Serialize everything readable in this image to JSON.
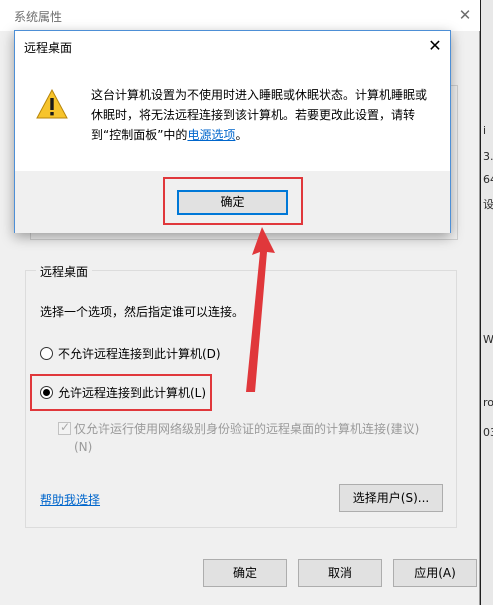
{
  "system_window": {
    "title": "系统属性",
    "close_glyph": "✕",
    "remote_desktop_group": {
      "legend": "远程桌面",
      "description": "选择一个选项，然后指定谁可以连接。",
      "option_disallow": "不允许远程连接到此计算机(D)",
      "option_allow": "允许远程连接到此计算机(L)",
      "selected_option": "allow",
      "nla_checkbox_label": "仅允许运行使用网络级别身份验证的远程桌面的计算机连接(建议)(N)",
      "nla_checked": true,
      "help_link": "帮助我选择",
      "select_users_button": "选择用户(S)..."
    },
    "buttons": {
      "ok": "确定",
      "cancel": "取消",
      "apply": "应用(A)"
    }
  },
  "dialog": {
    "title": "远程桌面",
    "close_glyph": "✕",
    "message_before_link": "这台计算机设置为不使用时进入睡眠或休眠状态。计算机睡眠或休眠时，将无法远程连接到该计算机。若要更改此设置，请转到“控制面板”中的",
    "message_link": "电源选项",
    "message_after_link": "。",
    "ok_button": "确定",
    "icon": "warning-icon"
  },
  "side_strip_chars": [
    "i",
    "3.",
    "64",
    "设",
    "W",
    "ro",
    "03"
  ],
  "colors": {
    "highlight": "#e0373b",
    "accent": "#0078d7",
    "link": "#0066cc"
  }
}
